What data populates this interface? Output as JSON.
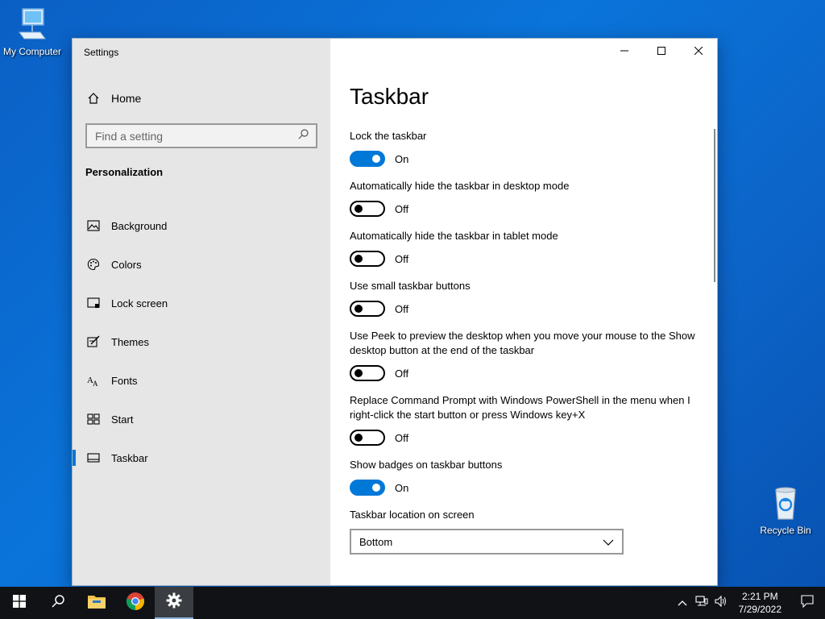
{
  "desktop": {
    "icons": [
      {
        "label": "My Computer",
        "icon": "computer-icon"
      },
      {
        "label": "Recycle Bin",
        "icon": "recycle-bin-icon"
      }
    ]
  },
  "window": {
    "title": "Settings",
    "controls": {
      "minimize": "minimize-icon",
      "maximize": "maximize-icon",
      "close": "close-icon"
    }
  },
  "sidebar": {
    "home_label": "Home",
    "search_placeholder": "Find a setting",
    "section_label": "Personalization",
    "items": [
      {
        "label": "Background",
        "icon": "picture-icon"
      },
      {
        "label": "Colors",
        "icon": "palette-icon"
      },
      {
        "label": "Lock screen",
        "icon": "lock-screen-icon"
      },
      {
        "label": "Themes",
        "icon": "themes-icon"
      },
      {
        "label": "Fonts",
        "icon": "fonts-icon"
      },
      {
        "label": "Start",
        "icon": "start-icon"
      },
      {
        "label": "Taskbar",
        "icon": "taskbar-icon",
        "active": true
      }
    ]
  },
  "main": {
    "title": "Taskbar",
    "settings": [
      {
        "label": "Lock the taskbar",
        "state": "On"
      },
      {
        "label": "Automatically hide the taskbar in desktop mode",
        "state": "Off"
      },
      {
        "label": "Automatically hide the taskbar in tablet mode",
        "state": "Off"
      },
      {
        "label": "Use small taskbar buttons",
        "state": "Off"
      },
      {
        "label": "Use Peek to preview the desktop when you move your mouse to the Show desktop button at the end of the taskbar",
        "state": "Off"
      },
      {
        "label": "Replace Command Prompt with Windows PowerShell in the menu when I right-click the start button or press Windows key+X",
        "state": "Off"
      },
      {
        "label": "Show badges on taskbar buttons",
        "state": "On"
      }
    ],
    "location_label": "Taskbar location on screen",
    "location_value": "Bottom"
  },
  "taskbar": {
    "time": "2:21 PM",
    "date": "7/29/2022",
    "accent": "#0078d7"
  }
}
